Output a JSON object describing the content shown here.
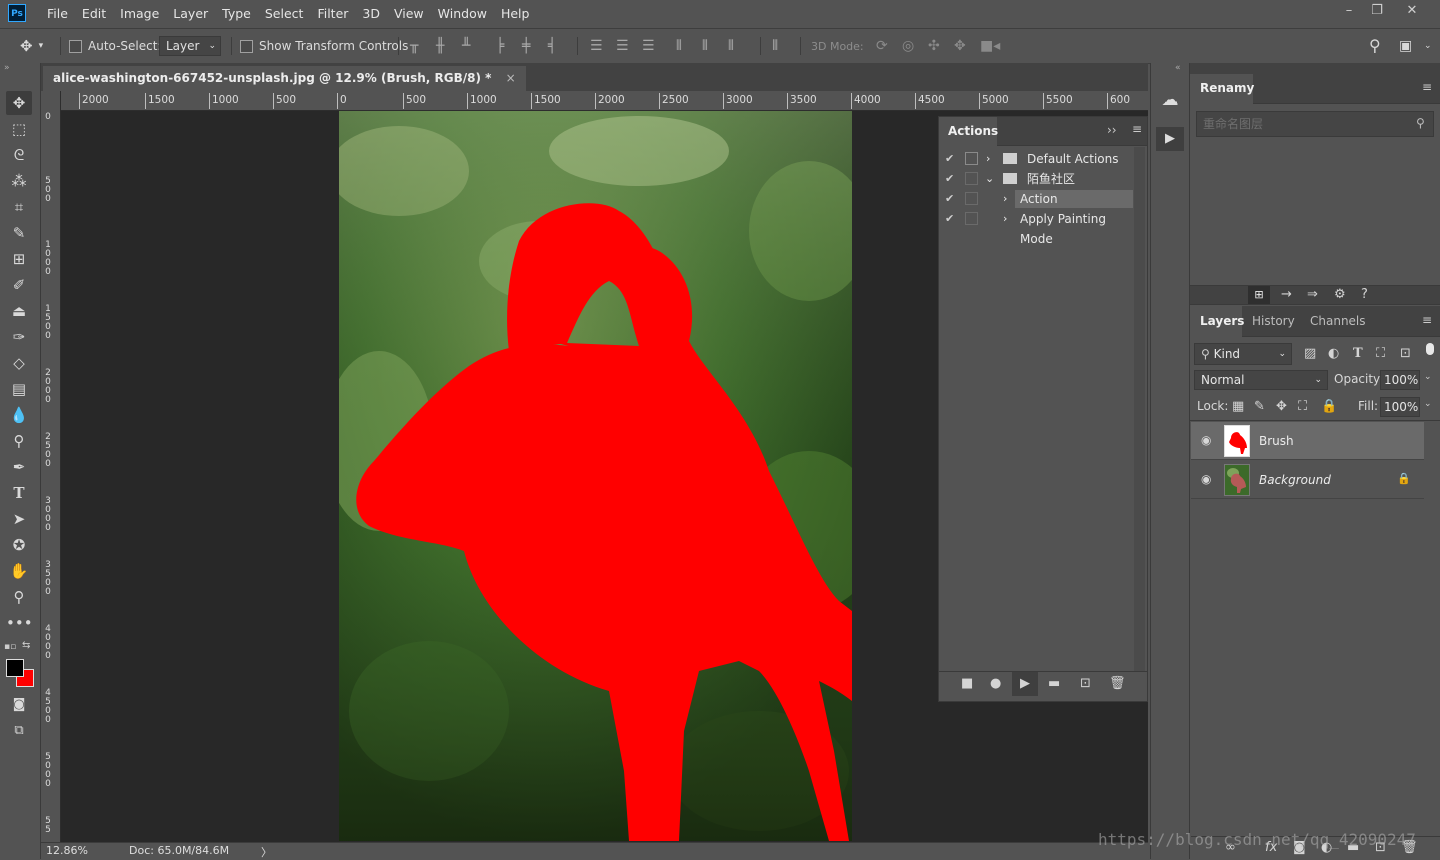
{
  "app": {
    "logo": "Ps"
  },
  "menu": [
    "File",
    "Edit",
    "Image",
    "Layer",
    "Type",
    "Select",
    "Filter",
    "3D",
    "View",
    "Window",
    "Help"
  ],
  "window_controls": {
    "minimize": "–",
    "restore": "❐",
    "close": "✕"
  },
  "options": {
    "auto_select_label": "Auto-Select:",
    "auto_select_value": "Layer",
    "show_transform_label": "Show Transform Controls",
    "mode_3d_label": "3D Mode:"
  },
  "document": {
    "tab_title": "alice-washington-667452-unsplash.jpg @ 12.9% (Brush, RGB/8) *",
    "tab_close": "×",
    "ruler_h": [
      "2000",
      "1500",
      "1000",
      "500",
      "0",
      "500",
      "1000",
      "1500",
      "2000",
      "2500",
      "3000",
      "3500",
      "4000",
      "4500",
      "5000",
      "5500",
      "600"
    ],
    "ruler_v": [
      "0",
      "500",
      "1000",
      "1500",
      "2000",
      "2500",
      "3000",
      "3500",
      "4000",
      "4500",
      "5000",
      "55"
    ]
  },
  "status": {
    "zoom": "12.86%",
    "doc": "Doc: 65.0M/84.6M",
    "arrow": "〉"
  },
  "actions_panel": {
    "title": "Actions",
    "items": [
      {
        "label": "Default Actions",
        "kind": "set"
      },
      {
        "label": "陌鱼社区",
        "kind": "set-open"
      },
      {
        "label": "Action",
        "kind": "action"
      },
      {
        "label": "Apply Painting Mode",
        "kind": "action"
      }
    ]
  },
  "renamy_panel": {
    "title": "Renamy",
    "search_placeholder": "重命名图层"
  },
  "layers_panel": {
    "tabs": [
      "Layers",
      "History",
      "Channels"
    ],
    "kind_label": "Kind",
    "blend_mode": "Normal",
    "opacity_label": "Opacity:",
    "opacity_value": "100%",
    "lock_label": "Lock:",
    "fill_label": "Fill:",
    "fill_value": "100%",
    "layers": [
      {
        "name": "Brush",
        "selected": true
      },
      {
        "name": "Background",
        "selected": false
      }
    ]
  },
  "colors": {
    "accent_red": "#ff0000",
    "foreground": "#000000",
    "background": "#ff0000"
  },
  "watermark": "https://blog.csdn.net/qq_42090247"
}
